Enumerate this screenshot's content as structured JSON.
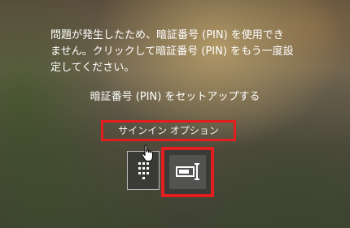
{
  "error_message": {
    "line1": "問題が発生したため、暗証番号 (PIN) を使用でき",
    "line2": "ません。クリックして暗証番号 (PIN) をもう一度設",
    "line3": "定してください。"
  },
  "setup_pin_link": "暗証番号 (PIN) をセットアップする",
  "signin_options": {
    "label": "サインイン オプション",
    "options": [
      {
        "icon": "pin-keypad-icon"
      },
      {
        "icon": "password-key-icon"
      }
    ]
  },
  "colors": {
    "highlight": "#e41e1e",
    "text": "#ffffff"
  }
}
